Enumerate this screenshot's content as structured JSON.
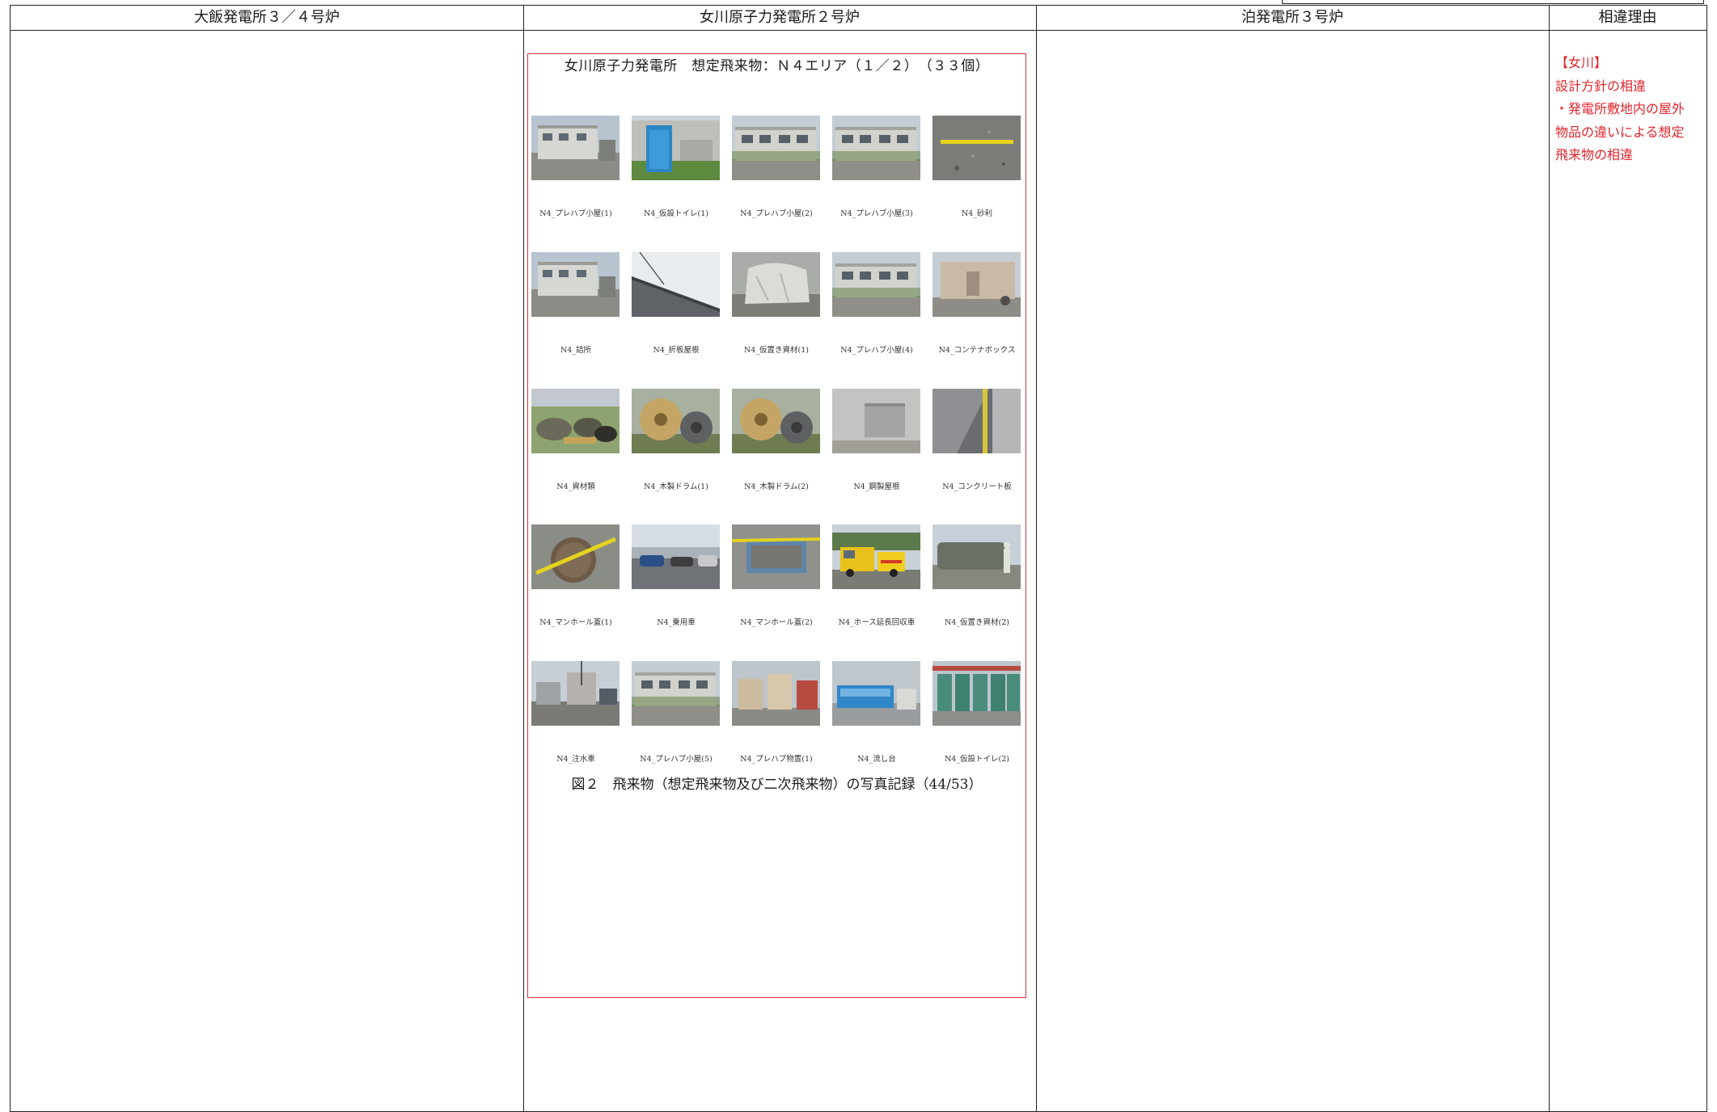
{
  "header": {
    "col1": "大飯発電所３／４号炉",
    "col2": "女川原子力発電所２号炉",
    "col3": "泊発電所３号炉",
    "col4": "相違理由"
  },
  "figure": {
    "title": "女川原子力発電所　想定飛来物：Ｎ４エリア（１／２）　（３３個）",
    "caption": "図２　飛来物（想定飛来物及び二次飛来物）の写真記録（44/53）",
    "photos": [
      {
        "label": "N4_プレハブ小屋(1)",
        "scene": "building"
      },
      {
        "label": "N4_仮設トイレ(1)",
        "scene": "toilet"
      },
      {
        "label": "N4_プレハブ小屋(2)",
        "scene": "prefab"
      },
      {
        "label": "N4_プレハブ小屋(3)",
        "scene": "prefab"
      },
      {
        "label": "N4_砂利",
        "scene": "gravel"
      },
      {
        "label": "N4_詰所",
        "scene": "building"
      },
      {
        "label": "N4_折板屋根",
        "scene": "roof"
      },
      {
        "label": "N4_仮置き資材(1)",
        "scene": "sheet"
      },
      {
        "label": "N4_プレハブ小屋(4)",
        "scene": "prefab"
      },
      {
        "label": "N4_コンテナボックス",
        "scene": "container"
      },
      {
        "label": "N4_資材類",
        "scene": "materials"
      },
      {
        "label": "N4_木製ドラム(1)",
        "scene": "drum"
      },
      {
        "label": "N4_木製ドラム(2)",
        "scene": "drum"
      },
      {
        "label": "N4_鋼製屋根",
        "scene": "wall"
      },
      {
        "label": "N4_コンクリート板",
        "scene": "concrete"
      },
      {
        "label": "N4_マンホール蓋(1)",
        "scene": "manhole"
      },
      {
        "label": "N4_乗用車",
        "scene": "cars"
      },
      {
        "label": "N4_マンホール蓋(2)",
        "scene": "manhole2"
      },
      {
        "label": "N4_ホース延長回収車",
        "scene": "truck"
      },
      {
        "label": "N4_仮置き資材(2)",
        "scene": "materials2"
      },
      {
        "label": "N4_注水車",
        "scene": "yard"
      },
      {
        "label": "N4_プレハブ小屋(5)",
        "scene": "prefab"
      },
      {
        "label": "N4_プレハブ物置(1)",
        "scene": "shed"
      },
      {
        "label": "N4_流し台",
        "scene": "sink"
      },
      {
        "label": "N4_仮設トイレ(2)",
        "scene": "toilets"
      }
    ]
  },
  "reason": {
    "lines": [
      "【女川】",
      "設計方針の相違",
      "・発電所敷地内の屋外",
      "物品の違いによる想定",
      "飛来物の相違"
    ]
  },
  "colors": {
    "border": "#222222",
    "accent": "#d9353f",
    "reason_text": "#e3242b"
  }
}
